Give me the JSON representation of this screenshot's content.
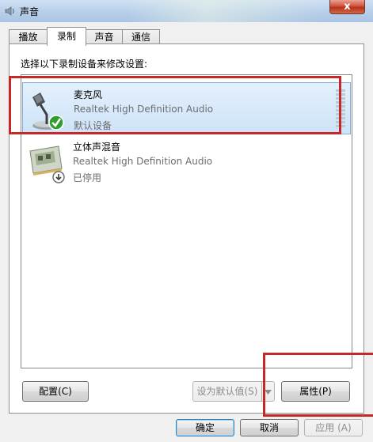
{
  "window": {
    "title": "声音",
    "close_label": "x"
  },
  "tabs": [
    {
      "label": "播放",
      "active": false
    },
    {
      "label": "录制",
      "active": true
    },
    {
      "label": "声音",
      "active": false
    },
    {
      "label": "通信",
      "active": false
    }
  ],
  "instruction": "选择以下录制设备来修改设置:",
  "devices": [
    {
      "name": "麦克风",
      "driver": "Realtek High Definition Audio",
      "status": "默认设备",
      "icon": "microphone-icon",
      "selected": true
    },
    {
      "name": "立体声混音",
      "driver": "Realtek High Definition Audio",
      "status": "已停用",
      "icon": "sound-card-icon",
      "selected": false
    }
  ],
  "buttons": {
    "configure": "配置(C)",
    "set_default": "设为默认值(S)",
    "properties": "属性(P)",
    "ok": "确定",
    "cancel": "取消",
    "apply": "应用 (A)"
  },
  "colors": {
    "annotation": "#c62828",
    "selection": "#cde3f8",
    "check": "#2e9e2e"
  }
}
